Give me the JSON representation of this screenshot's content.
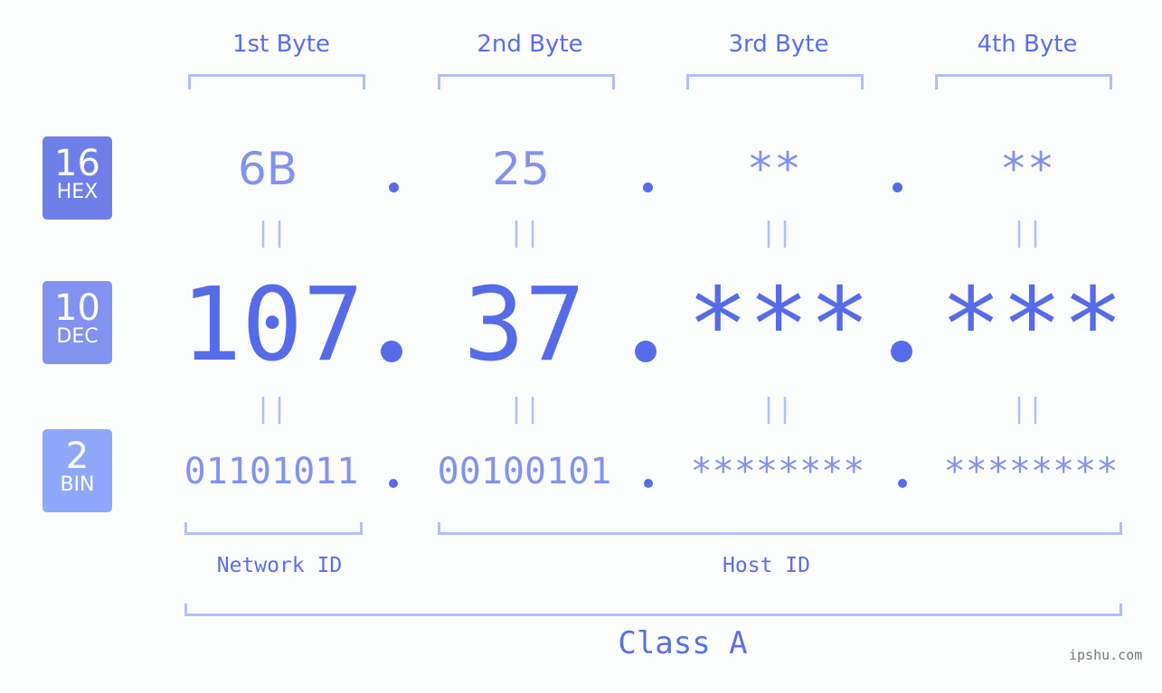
{
  "badges": [
    {
      "number": "16",
      "label": "HEX",
      "color": "#6f7fe9"
    },
    {
      "number": "10",
      "label": "DEC",
      "color": "#8292f0"
    },
    {
      "number": "2",
      "label": "BIN",
      "color": "#8fa7f8"
    }
  ],
  "byte_headers": [
    "1st Byte",
    "2nd Byte",
    "3rd Byte",
    "4th Byte"
  ],
  "hex": [
    "6B",
    "25",
    "**",
    "**"
  ],
  "dec": [
    "107",
    "37",
    "***",
    "***"
  ],
  "bin": [
    "01101011",
    "00100101",
    "********",
    "********"
  ],
  "equals_symbol": "||",
  "network_id_label": "Network ID",
  "host_id_label": "Host ID",
  "class_label": "Class A",
  "watermark": "ipshu.com",
  "colors": {
    "accent": "#566be8",
    "light_accent": "#8391ee",
    "bracket": "#b4bdf8",
    "background": "#fbfcfc"
  }
}
